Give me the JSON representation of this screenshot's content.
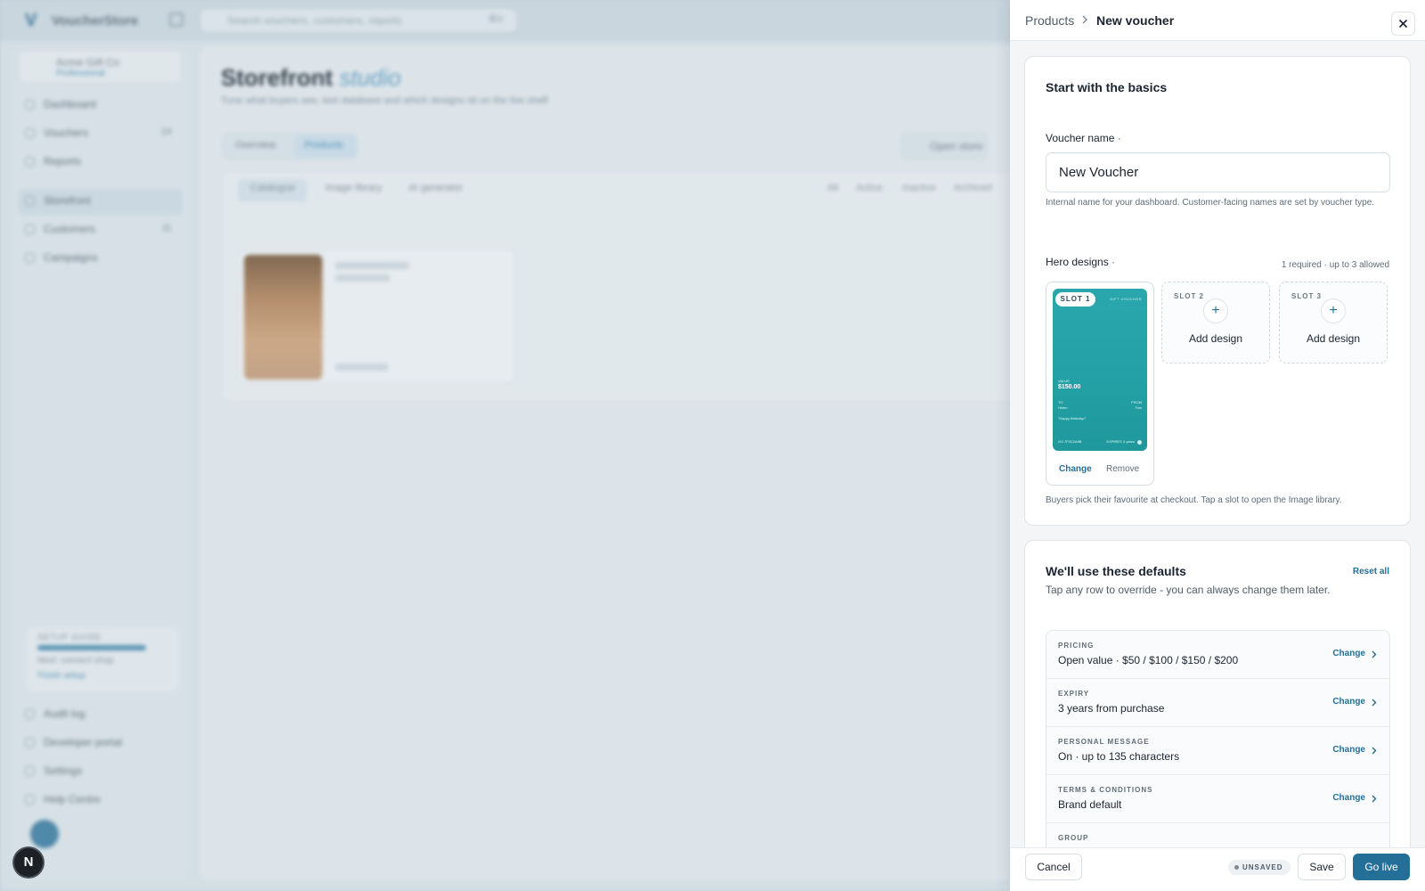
{
  "background": {
    "app_name": "VoucherStore",
    "search_placeholder": "Search vouchers, customers, reports",
    "search_shortcut": "⌘K",
    "org": {
      "name": "Acme Gift Co",
      "plan": "Professional"
    },
    "nav": [
      {
        "label": "Dashboard",
        "badge": ""
      },
      {
        "label": "Vouchers",
        "badge": "24"
      },
      {
        "label": "Reports",
        "badge": ""
      },
      {
        "label": "Storefront",
        "badge": ""
      },
      {
        "label": "Customers",
        "badge": "11"
      },
      {
        "label": "Campaigns",
        "badge": ""
      }
    ],
    "nav_bottom": [
      "Audit log",
      "Developer portal",
      "Settings",
      "Help Centre"
    ],
    "setup": {
      "title": "SETUP GUIDE",
      "count": "5/6",
      "subtitle": "Next: connect shop",
      "link": "Finish setup"
    },
    "page_title": "Storefront",
    "page_title_accent": "studio",
    "page_subtitle": "Tune what buyers see, test database and which designs sit on the live shelf",
    "tabs": [
      "Overview",
      "Products"
    ],
    "open_store": "Open store",
    "subtabs": [
      "Catalogue",
      "Image library",
      "AI generator"
    ],
    "filters": [
      "All",
      "Active",
      "Inactive",
      "Archived"
    ],
    "launcher_letter": "N"
  },
  "drawer": {
    "breadcrumb": {
      "parent": "Products",
      "current": "New voucher"
    },
    "basics": {
      "title": "Start with the basics",
      "name_label": "Voucher name",
      "required_dot": "·",
      "name_value": "New Voucher",
      "name_help": "Internal name for your dashboard. Customer-facing names are set by voucher type.",
      "hero_label": "Hero designs",
      "hero_allowance": "1 required · up to 3 allowed",
      "slot1": {
        "label": "SLOT 1",
        "art_tag": "GIFT VOUCHER",
        "art_value_label": "VALUE",
        "art_value": "$150.00",
        "art_to_label": "TO",
        "art_to": "Helen",
        "art_from_label": "FROM",
        "art_from": "Tom",
        "art_message": "\"Happy Birthday!\"",
        "art_code": "GV-7F3C2A9B",
        "art_expiry": "EXPIRES 3 years",
        "change": "Change",
        "remove": "Remove"
      },
      "slot2": {
        "label": "SLOT 2",
        "add": "Add design"
      },
      "slot3": {
        "label": "SLOT 3",
        "add": "Add design"
      },
      "hero_help": "Buyers pick their favourite at checkout. Tap a slot to open the Image library."
    },
    "defaults": {
      "title": "We'll use these defaults",
      "reset": "Reset all",
      "subtitle": "Tap any row to override - you can always change them later.",
      "rows": [
        {
          "key": "PRICING",
          "value": "Open value · $50 / $100 / $150 / $200",
          "action": "Change"
        },
        {
          "key": "EXPIRY",
          "value": "3 years from purchase",
          "action": "Change"
        },
        {
          "key": "PERSONAL MESSAGE",
          "value": "On · up to 135 characters",
          "action": "Change"
        },
        {
          "key": "TERMS & CONDITIONS",
          "value": "Brand default",
          "action": "Change"
        },
        {
          "key": "GROUP",
          "value": "",
          "action": ""
        }
      ]
    },
    "footer": {
      "cancel": "Cancel",
      "status": "UNSAVED",
      "save": "Save",
      "go_live": "Go live"
    }
  },
  "colors": {
    "accent": "#236f97",
    "voucher_teal": "#22a0a4"
  }
}
